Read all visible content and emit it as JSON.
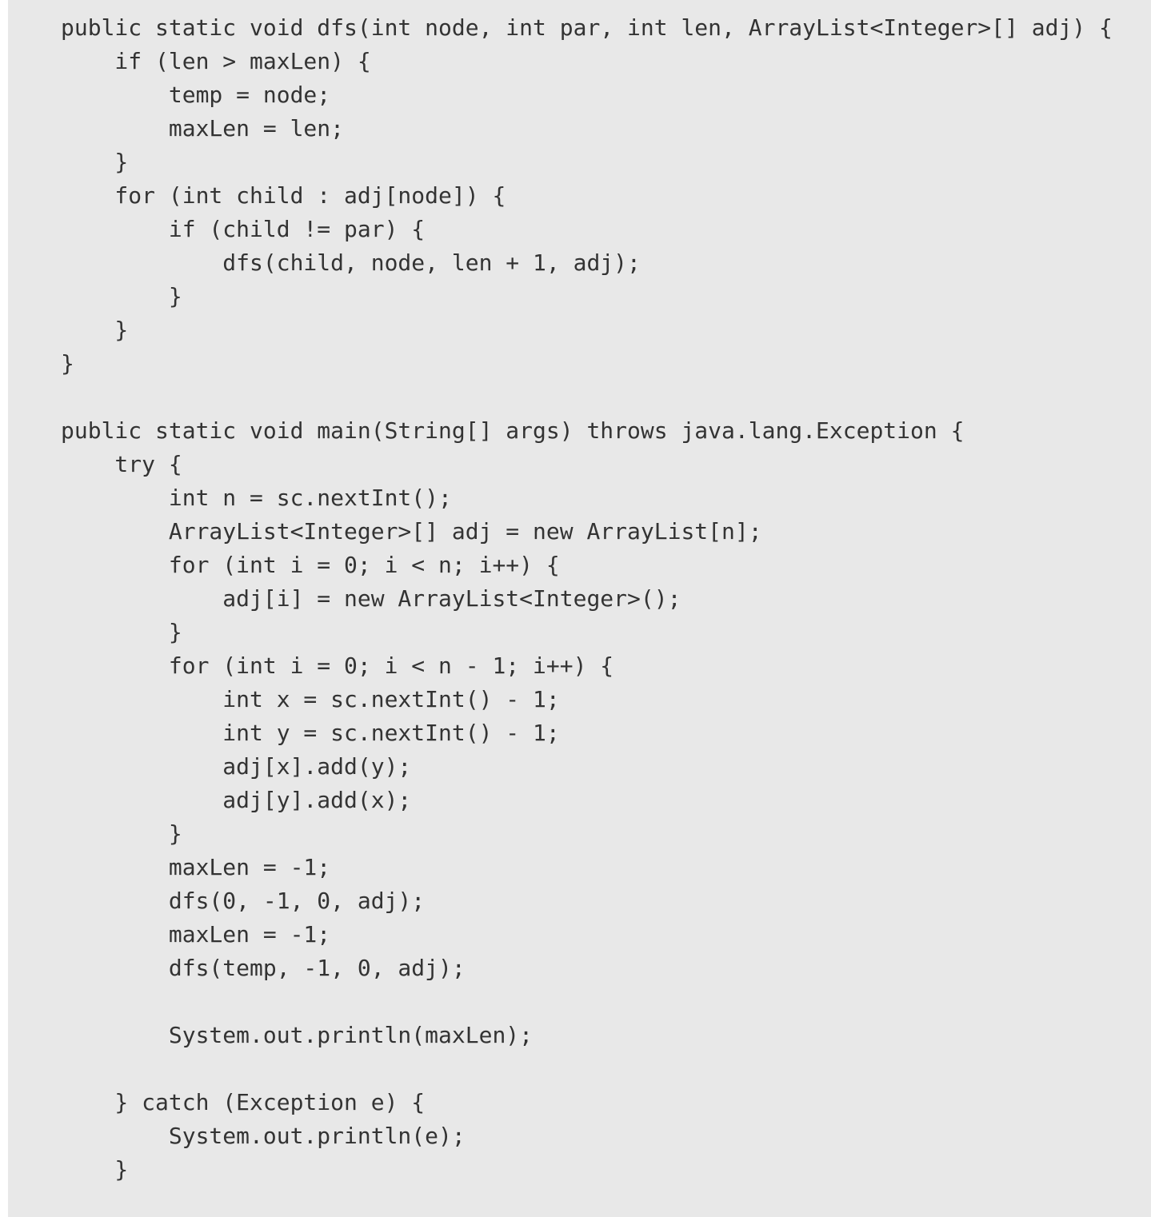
{
  "theme": {
    "background": "#e8e8e8",
    "text_color": "#333333"
  },
  "code": {
    "language": "java",
    "lines": [
      "public static void dfs(int node, int par, int len, ArrayList<Integer>[] adj) {",
      "    if (len > maxLen) {",
      "        temp = node;",
      "        maxLen = len;",
      "    }",
      "    for (int child : adj[node]) {",
      "        if (child != par) {",
      "            dfs(child, node, len + 1, adj);",
      "        }",
      "    }",
      "}",
      "",
      "public static void main(String[] args) throws java.lang.Exception {",
      "    try {",
      "        int n = sc.nextInt();",
      "        ArrayList<Integer>[] adj = new ArrayList[n];",
      "        for (int i = 0; i < n; i++) {",
      "            adj[i] = new ArrayList<Integer>();",
      "        }",
      "        for (int i = 0; i < n - 1; i++) {",
      "            int x = sc.nextInt() - 1;",
      "            int y = sc.nextInt() - 1;",
      "            adj[x].add(y);",
      "            adj[y].add(x);",
      "        }",
      "        maxLen = -1;",
      "        dfs(0, -1, 0, adj);",
      "        maxLen = -1;",
      "        dfs(temp, -1, 0, adj);",
      "",
      "        System.out.println(maxLen);",
      "",
      "    } catch (Exception e) {",
      "        System.out.println(e);",
      "    }"
    ]
  }
}
